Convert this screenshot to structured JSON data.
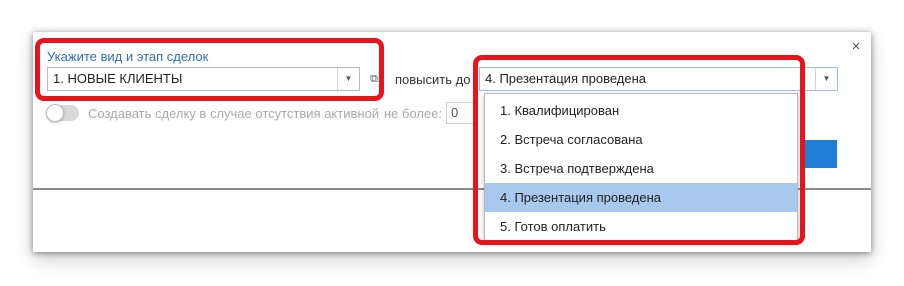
{
  "dialog": {
    "close_glyph": "×"
  },
  "deal_type": {
    "label": "Укажите вид и этап сделок",
    "value": "1. НОВЫЕ КЛИЕНТЫ",
    "arrow_glyph": "▼",
    "open_glyph": "⧉"
  },
  "raise_to": {
    "label": "повысить до",
    "value": "4. Презентация проведена",
    "arrow_glyph": "▼"
  },
  "create_option": {
    "label": "Создавать сделку в случае отсутствия активной",
    "limit_label": "не более:",
    "limit_value": "0"
  },
  "dropdown": {
    "items": [
      {
        "label": "1. Квалифицирован"
      },
      {
        "label": "2. Встреча согласована"
      },
      {
        "label": "3. Встреча подтверждена"
      },
      {
        "label": "4. Презентация проведена",
        "selected": true
      },
      {
        "label": "5. Готов оплатить"
      }
    ]
  },
  "colors": {
    "accent": "#1f7ed6",
    "link": "#2f6fb7",
    "selected_item": "#a9c8ee",
    "highlight": "#e8141c"
  }
}
